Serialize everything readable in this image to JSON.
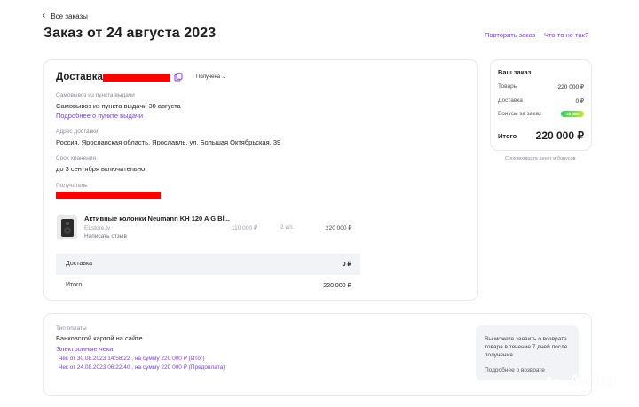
{
  "nav": {
    "back_label": "Все заказы"
  },
  "header": {
    "title": "Заказ от 24 августа 2023",
    "repeat_label": "Повторить заказ",
    "problem_label": "Что-то не так?"
  },
  "delivery": {
    "title": "Доставка",
    "status": "Получена",
    "pickup_label": "Самовывоз из пункта выдачи",
    "pickup_value": "Самовывоз из пункта выдачи 30 августа",
    "pickup_link": "Подробнее о пункте выдачи",
    "address_label": "Адрес доставки",
    "address_value": "Россия, Ярославская область, Ярославль, ул. Большая Октябрьская, 39",
    "storage_label": "Срок хранения",
    "storage_value": "до 3 сентября включительно",
    "recipient_label": "Получатель"
  },
  "product": {
    "title": "Активные колонки Neumann KH 120 A G Bl...",
    "seller": "ELstore.tv",
    "review_label": "Написать отзыв",
    "price": "110 000 ₽",
    "qty": "2 шт.",
    "sum": "220 000 ₽"
  },
  "totals": {
    "delivery_label": "Доставка",
    "delivery_value": "0 ₽",
    "total_label": "Итого",
    "total_value": "220 000 ₽"
  },
  "summary": {
    "title": "Ваш заказ",
    "goods_label": "Товары",
    "goods_value": "220 000 ₽",
    "delivery_label": "Доставка",
    "delivery_value": "0 ₽",
    "bonus_label": "Бонусы за заказ",
    "bonus_value": "20 000",
    "total_label": "Итого",
    "total_value": "220 000 ₽",
    "refund_terms": "Срок возврата денег и бонусов"
  },
  "payment": {
    "type_label": "Тип оплаты",
    "type_value": "Банковской картой на сайте",
    "receipts_label": "Электронные чеки",
    "receipt1": "Чек от 30.08.2023 14:58:22 , на сумму 220 000 ₽ (Итог)",
    "receipt2": "Чек от 24.08.2023 06:22:40 , на сумму 220 000 ₽ (Предоплата)",
    "note": "Вы можете заявить о возврате товара в течение 7 дней после получения",
    "note_link": "Подробнее о возврате"
  },
  "watermark": "Avito",
  "colors": {
    "accent": "#7b3fe4",
    "redaction": "#ff0000",
    "panel_bg": "#f2f3f7"
  }
}
